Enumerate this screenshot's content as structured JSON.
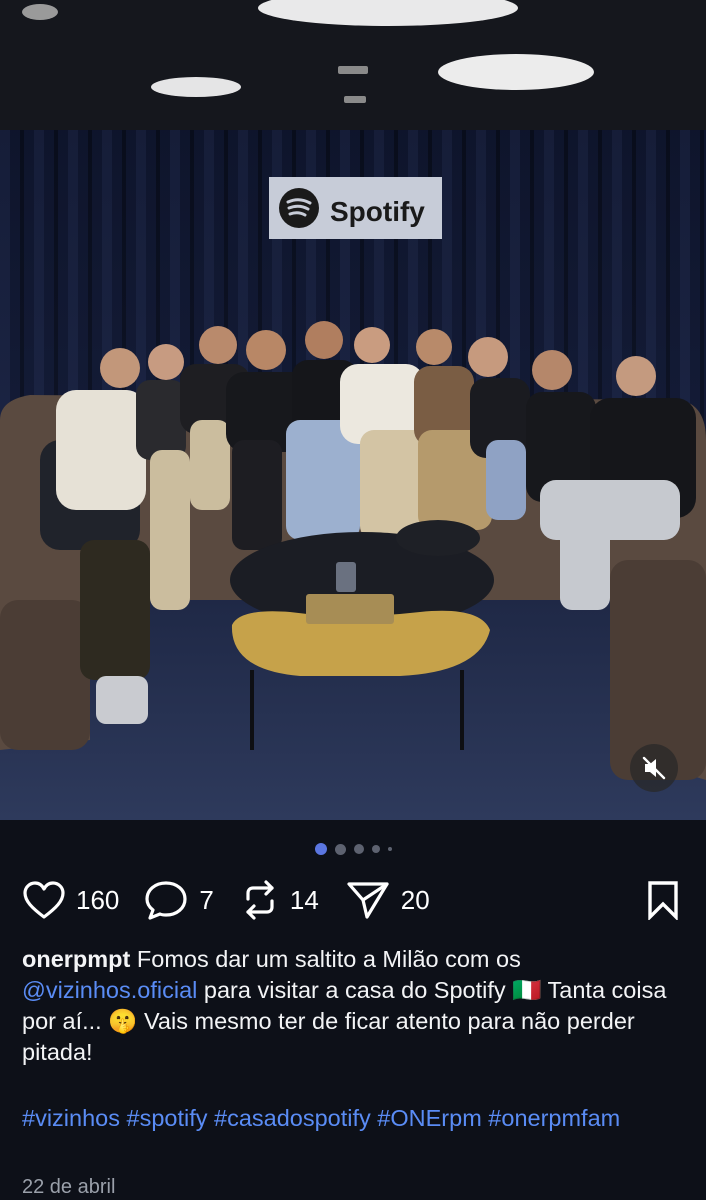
{
  "post": {
    "photo": {
      "sign_text": "Spotify",
      "description_icon": "group-photo-image",
      "mute_icon": "speaker-muted-icon"
    },
    "carousel": {
      "count": 5,
      "active_index": 0
    },
    "actions": {
      "likes": "160",
      "comments": "7",
      "reposts": "14",
      "shares": "20"
    },
    "caption": {
      "username": "onerpmpt",
      "text_part1": " Fomos dar um saltito a Milão com os ",
      "mention": "@vizinhos.oficial",
      "text_part2": " para visitar a casa do Spotify 🇮🇹 Tanta coisa por aí... 🤫  Vais mesmo ter de ficar atento para não perder pitada!"
    },
    "hashtags": "#vizinhos #spotify #casadospotify #ONErpm #onerpmfam",
    "date": "22 de abril"
  },
  "colors": {
    "background": "#0d1018",
    "link": "#5a8cf5",
    "dot_active": "#5b76e0",
    "dot_inactive": "#5d6270"
  }
}
